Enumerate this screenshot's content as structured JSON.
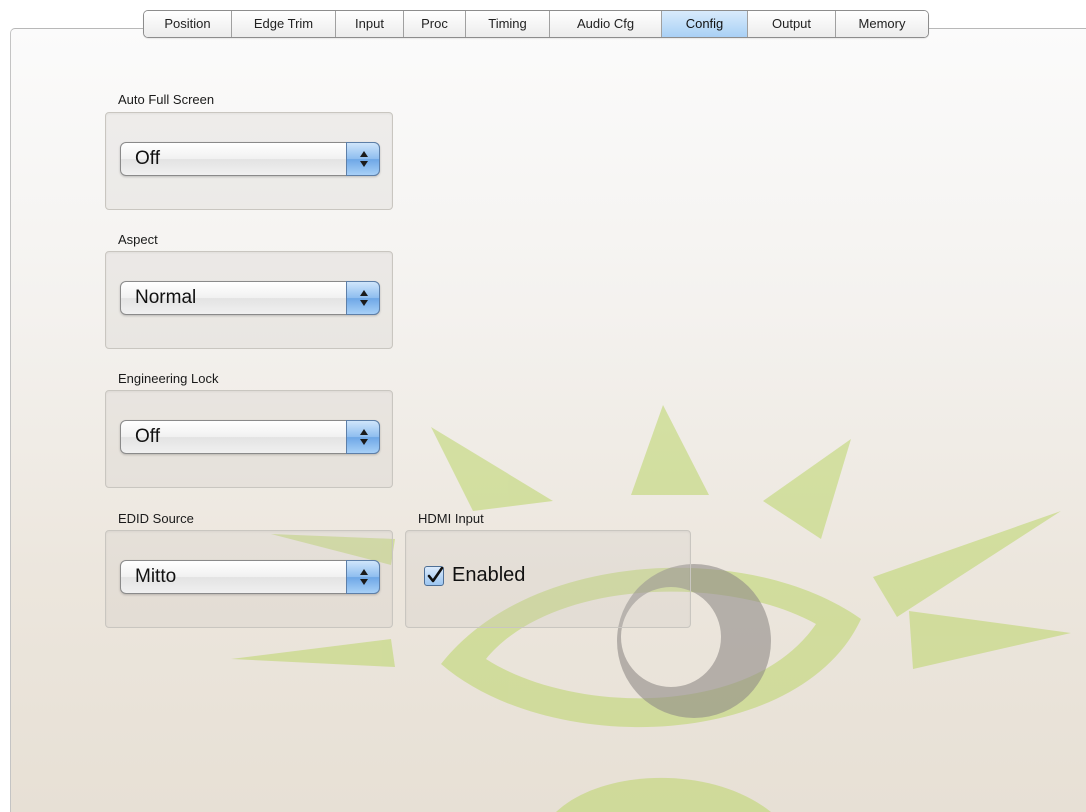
{
  "tabs": [
    {
      "label": "Position",
      "active": false
    },
    {
      "label": "Edge Trim",
      "active": false
    },
    {
      "label": "Input",
      "active": false
    },
    {
      "label": "Proc",
      "active": false
    },
    {
      "label": "Timing",
      "active": false
    },
    {
      "label": "Audio Cfg",
      "active": false
    },
    {
      "label": "Config",
      "active": true
    },
    {
      "label": "Output",
      "active": false
    },
    {
      "label": "Memory",
      "active": false
    }
  ],
  "groups": {
    "auto_full_screen": {
      "label": "Auto Full Screen",
      "value": "Off"
    },
    "aspect": {
      "label": "Aspect",
      "value": "Normal"
    },
    "engineering_lock": {
      "label": "Engineering Lock",
      "value": "Off"
    },
    "edid_source": {
      "label": "EDID Source",
      "value": "Mitto"
    },
    "hdmi_input": {
      "label": "HDMI Input",
      "checkbox_label": "Enabled",
      "checked": true
    }
  },
  "colors": {
    "active_tab": "#a9d0f5",
    "stepper_blue": "#6ea7e6",
    "watermark_green": "#c2d97a",
    "watermark_gray": "#a8a5a2"
  }
}
